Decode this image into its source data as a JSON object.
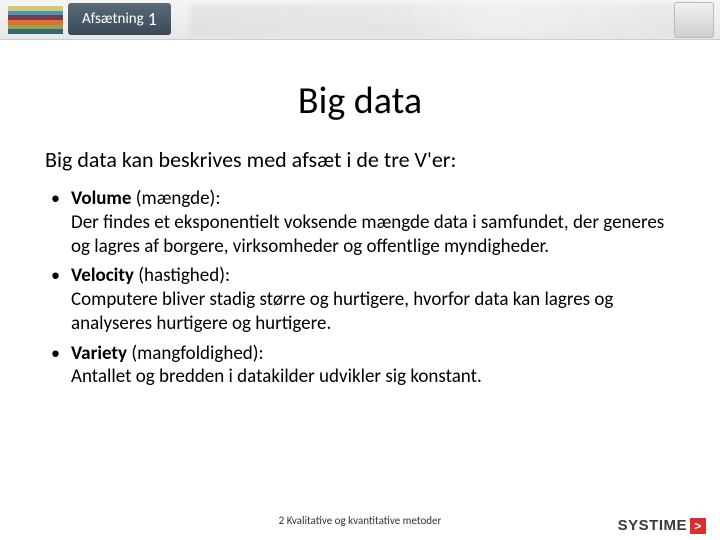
{
  "header": {
    "tab_label": "Afsætning",
    "tab_number": "1"
  },
  "title": "Big data",
  "intro": "Big data kan beskrives med afsæt i de tre V'er:",
  "bullets": [
    {
      "term": "Volume",
      "paren": "(mængde):",
      "body": "Der findes et eksponentielt voksende mængde data i samfundet, der generes og lagres af borgere, virksomheder og offentlige myndigheder."
    },
    {
      "term": "Velocity",
      "paren": "(hastighed):",
      "body": "Computere bliver stadig større og hurtigere, hvorfor data kan lagres og analyseres hurtigere og hurtigere."
    },
    {
      "term": "Variety",
      "paren": "(mangfoldighed):",
      "body": "Antallet og bredden i datakilder udvikler sig konstant."
    }
  ],
  "footer": {
    "chapter": "2 Kvalitative og kvantitative metoder"
  },
  "brand": {
    "name": "SYSTIME",
    "glyph": ">"
  }
}
